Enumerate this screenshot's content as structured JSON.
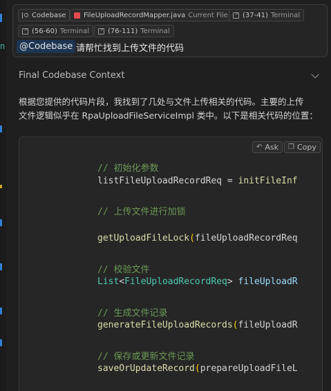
{
  "context_chips": [
    {
      "icon": "branch-icon",
      "label": "Codebase"
    },
    {
      "icon": "java-file-icon",
      "label": "FileUploadRecordMapper.java",
      "suffix": "Current File"
    },
    {
      "icon": "terminal-icon",
      "label": "(37-41)",
      "suffix": "Terminal"
    },
    {
      "icon": "terminal-icon",
      "label": "(56-60)",
      "suffix": "Terminal"
    },
    {
      "icon": "terminal-icon",
      "label": "(76-111)",
      "suffix": "Terminal"
    }
  ],
  "query": {
    "mention": "@Codebase",
    "text": "请帮忙找到上传文件的代码"
  },
  "context_section": {
    "title": "Final Codebase Context"
  },
  "answer": {
    "line1": "根据您提供的代码片段，我找到了几处与文件上传相关的代码。主要的上传",
    "line2": "文件逻辑似乎在 RpaUploadFileServiceImpl 类中。以下是相关代码的位置："
  },
  "code_actions": {
    "ask": "Ask",
    "copy": "Copy"
  },
  "code": {
    "c1": "// 初始化参数",
    "l1_fn": "listFileUploadRecordReq",
    "l1_op": " = ",
    "l1_call": "initFileInf",
    "c2": "// 上传文件进行加锁",
    "l2_fn": "getUploadFileLock",
    "l2_p": "(",
    "l2_arg": "fileUploadRecordReq",
    "c3": "// 校验文件",
    "l3_type": "List",
    "l3_lt": "<",
    "l3_generic": "FileUploadRecordReq",
    "l3_gt": "> ",
    "l3_var": "fileUploadR",
    "c4": "// 生成文件记录",
    "l4_fn": "generateFileUploadRecords",
    "l4_p": "(",
    "l4_arg": "fileUploadR",
    "c5": "// 保存或更新文件记录",
    "l5_fn": "saveOrUpdateRecord",
    "l5_p": "(",
    "l5_arg": "prepareUploadFileL"
  }
}
